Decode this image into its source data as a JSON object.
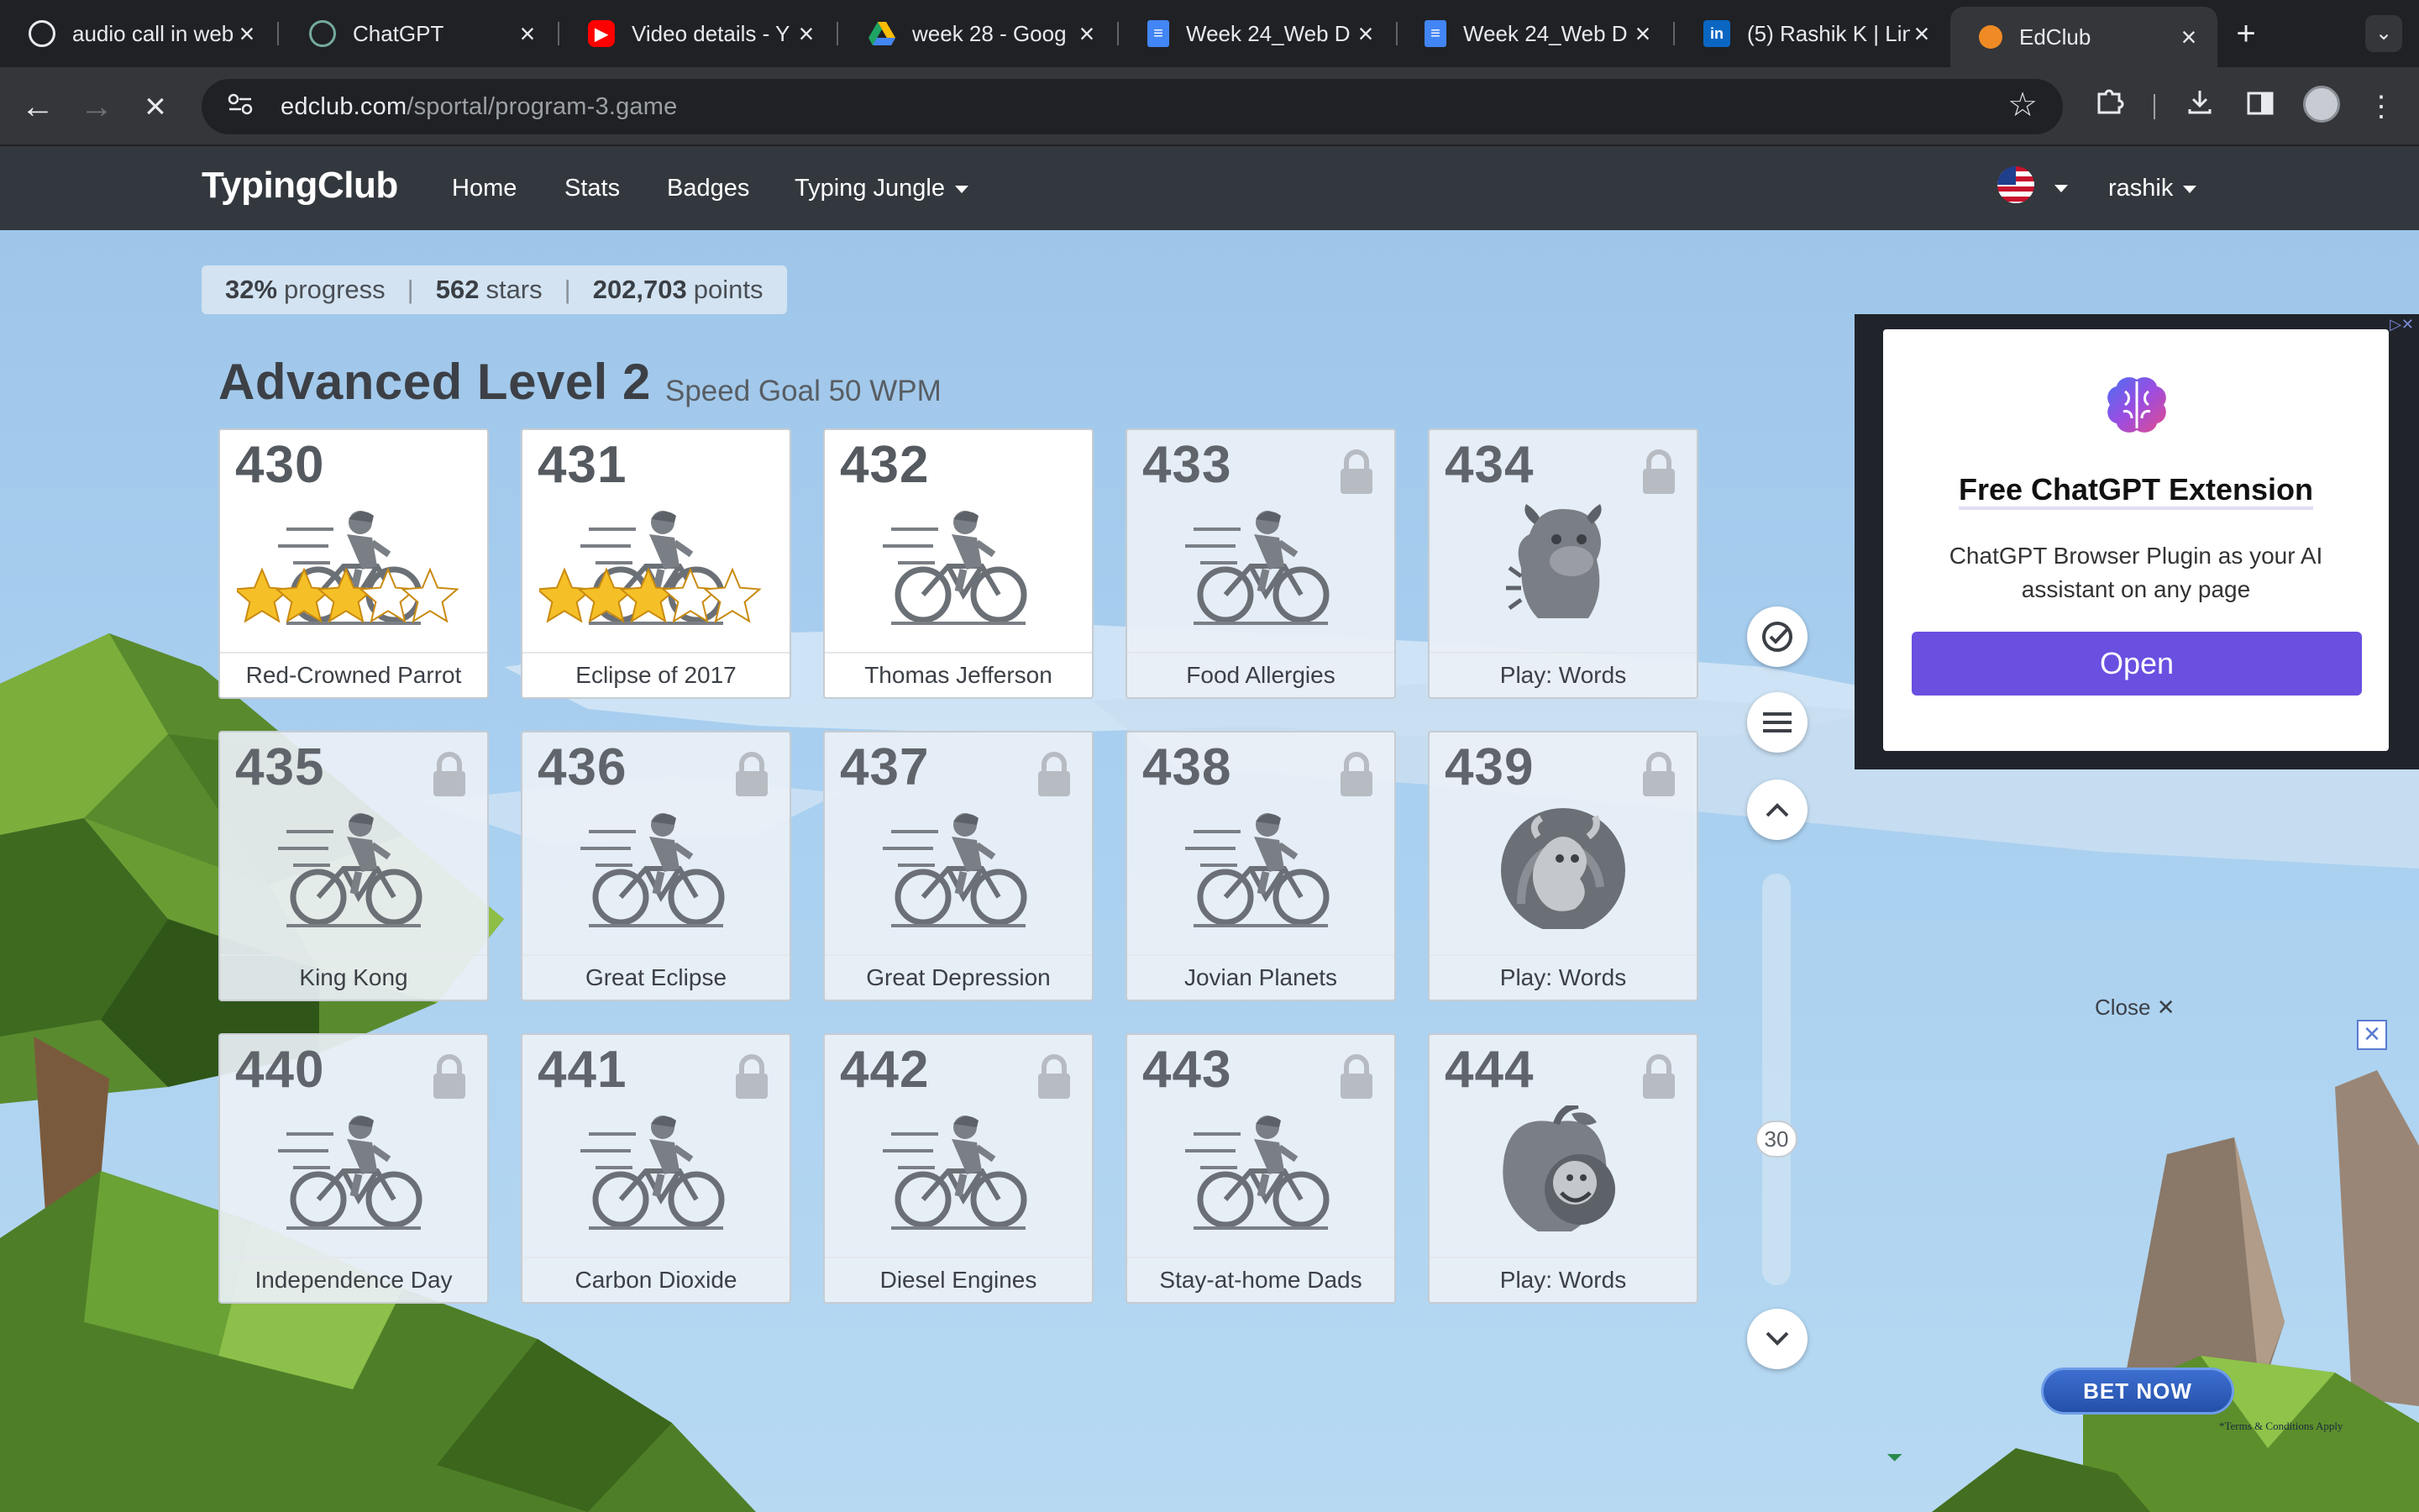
{
  "browser": {
    "tabs": [
      {
        "title": "audio call in web",
        "icon": "audio-icon",
        "color": "#e8eaed"
      },
      {
        "title": "ChatGPT",
        "icon": "chatgpt-icon",
        "color": "#74aa9c"
      },
      {
        "title": "Video details - Y",
        "icon": "youtube-icon",
        "color": "#ff0000"
      },
      {
        "title": "week 28 - Goog",
        "icon": "google-drive-icon",
        "color": "#fbbc04"
      },
      {
        "title": "Week 24_Web D",
        "icon": "google-docs-icon",
        "color": "#4285f4"
      },
      {
        "title": "Week 24_Web D",
        "icon": "google-docs-icon",
        "color": "#4285f4"
      },
      {
        "title": "(5) Rashik K | Lin",
        "icon": "linkedin-icon",
        "color": "#0a66c2"
      },
      {
        "title": "EdClub",
        "icon": "edclub-icon",
        "color": "#f08a24"
      }
    ],
    "url_domain": "edclub.com",
    "url_path": "/sportal/program-3.game"
  },
  "site": {
    "logo": "TypingClub",
    "nav": [
      "Home",
      "Stats",
      "Badges",
      "Typing Jungle"
    ],
    "user": "rashik"
  },
  "stats": {
    "progress_value": "32%",
    "progress_label": "progress",
    "stars_value": "562",
    "stars_label": "stars",
    "points_value": "202,703",
    "points_label": "points"
  },
  "level": {
    "title": "Advanced Level 2",
    "goal": "Speed Goal 50 WPM"
  },
  "lessons": [
    {
      "num": "430",
      "label": "Red-Crowned Parrot",
      "locked": false,
      "icon": "cyclist-icon",
      "stars": 3
    },
    {
      "num": "431",
      "label": "Eclipse of 2017",
      "locked": false,
      "icon": "cyclist-icon",
      "stars": 3
    },
    {
      "num": "432",
      "label": "Thomas Jefferson",
      "locked": false,
      "icon": "cyclist-icon",
      "stars": 0
    },
    {
      "num": "433",
      "label": "Food Allergies",
      "locked": true,
      "icon": "cyclist-icon",
      "stars": 0
    },
    {
      "num": "434",
      "label": "Play: Words",
      "locked": true,
      "icon": "monster-icon",
      "stars": 0
    },
    {
      "num": "435",
      "label": "King Kong",
      "locked": true,
      "icon": "cyclist-icon",
      "stars": 0
    },
    {
      "num": "436",
      "label": "Great Eclipse",
      "locked": true,
      "icon": "cyclist-icon",
      "stars": 0
    },
    {
      "num": "437",
      "label": "Great Depression",
      "locked": true,
      "icon": "cyclist-icon",
      "stars": 0
    },
    {
      "num": "438",
      "label": "Jovian Planets",
      "locked": true,
      "icon": "cyclist-icon",
      "stars": 0
    },
    {
      "num": "439",
      "label": "Play: Words",
      "locked": true,
      "icon": "creature-icon",
      "stars": 0
    },
    {
      "num": "440",
      "label": "Independence Day",
      "locked": true,
      "icon": "cyclist-icon",
      "stars": 0
    },
    {
      "num": "441",
      "label": "Carbon Dioxide",
      "locked": true,
      "icon": "cyclist-icon",
      "stars": 0
    },
    {
      "num": "442",
      "label": "Diesel Engines",
      "locked": true,
      "icon": "cyclist-icon",
      "stars": 0
    },
    {
      "num": "443",
      "label": "Stay-at-home Dads",
      "locked": true,
      "icon": "cyclist-icon",
      "stars": 0
    },
    {
      "num": "444",
      "label": "Play: Words",
      "locked": true,
      "icon": "apple-creature-icon",
      "stars": 0
    }
  ],
  "controls": {
    "slider_value": "30"
  },
  "ad": {
    "title": "Free ChatGPT Extension",
    "description": "ChatGPT Browser Plugin as your AI assistant on any page",
    "button": "Open",
    "close_label": "Close ✕",
    "bet_button": "BET NOW",
    "terms": "*Terms & Conditions Apply",
    "accent_color": "#6a4fe0"
  }
}
